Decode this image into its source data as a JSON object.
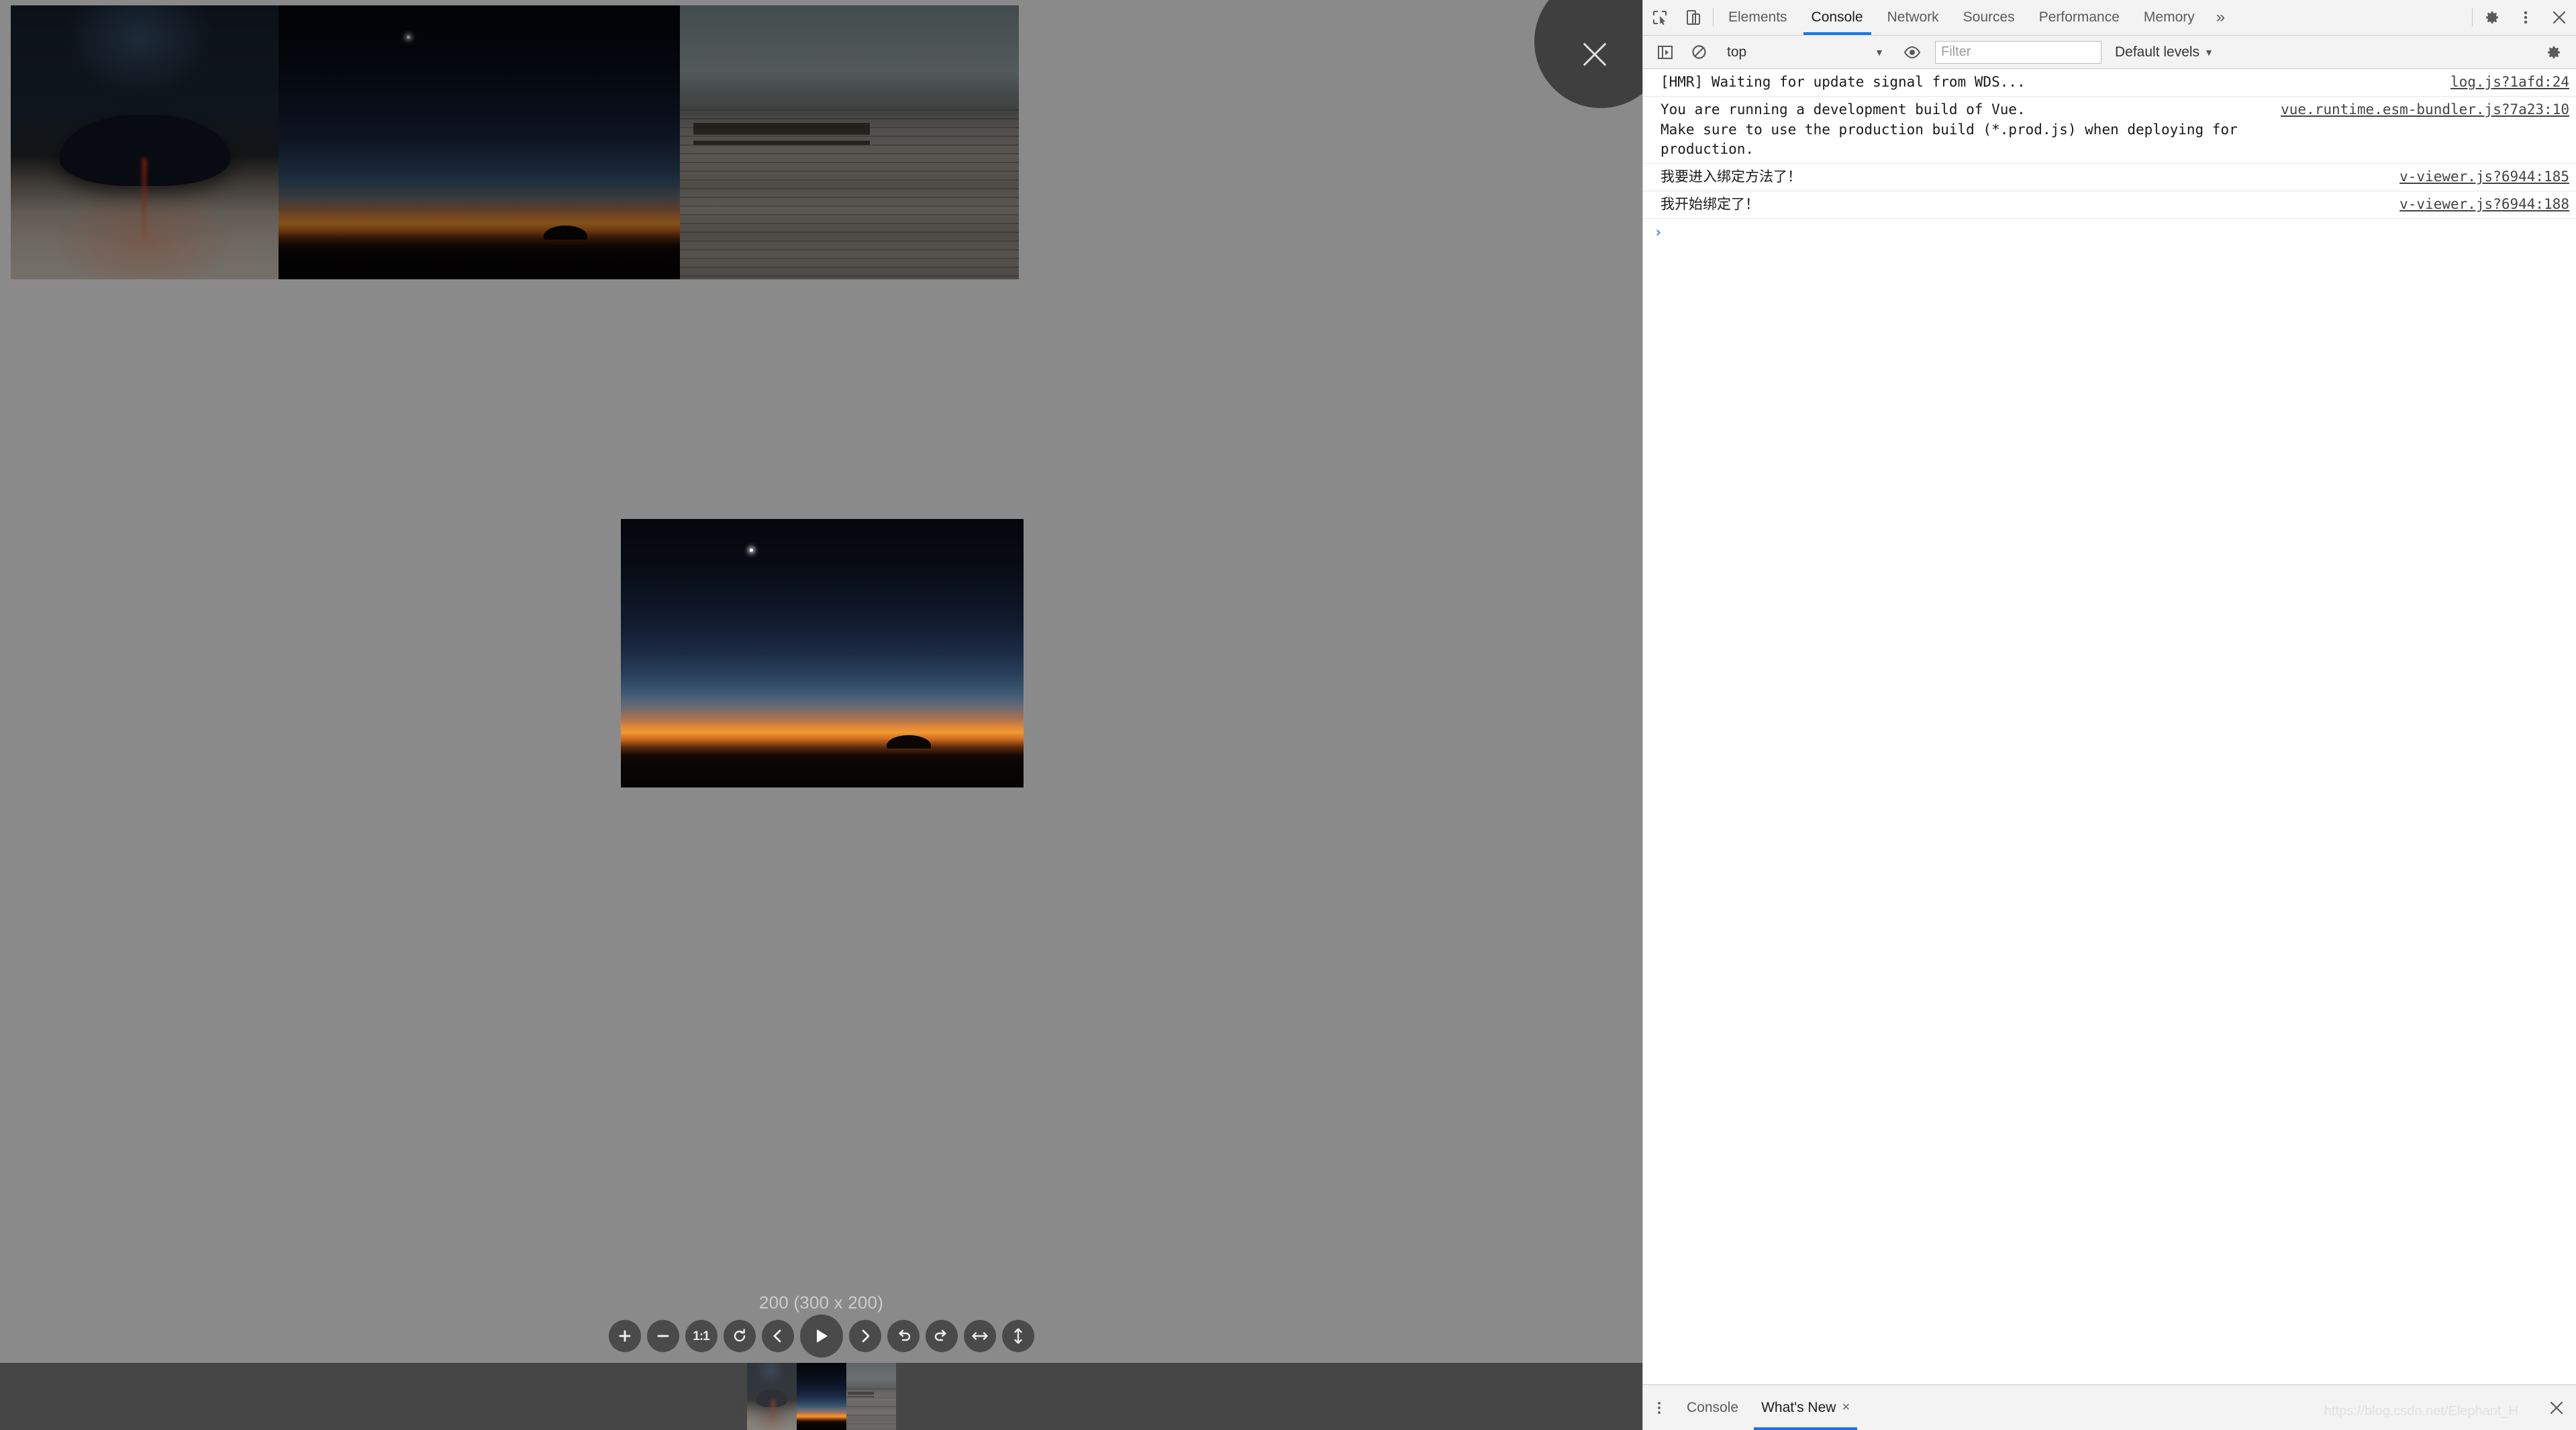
{
  "page": {
    "images": [
      {
        "name": "image-controller",
        "alt": "dark game controller with red light"
      },
      {
        "name": "image-sunset",
        "alt": "twilight horizon with orange glow and a star"
      },
      {
        "name": "image-boardwalk",
        "alt": "wooden boardwalk with bench by the sea"
      }
    ]
  },
  "viewer": {
    "close_label": "×",
    "title": "200 (300 x 200)",
    "active_index": 1,
    "toolbar": [
      {
        "name": "zoom-in-icon",
        "label": "+",
        "title": "Zoom in"
      },
      {
        "name": "zoom-out-icon",
        "label": "−",
        "title": "Zoom out"
      },
      {
        "name": "one-to-one-icon",
        "label": "1:1",
        "title": "Reset zoom (1:1)"
      },
      {
        "name": "reset-icon",
        "label": "",
        "title": "Reset"
      },
      {
        "name": "prev-icon",
        "label": "",
        "title": "Previous"
      },
      {
        "name": "play-icon",
        "label": "",
        "title": "Play slideshow"
      },
      {
        "name": "next-icon",
        "label": "",
        "title": "Next"
      },
      {
        "name": "rotate-left-icon",
        "label": "",
        "title": "Rotate left"
      },
      {
        "name": "rotate-right-icon",
        "label": "",
        "title": "Rotate right"
      },
      {
        "name": "flip-horizontal-icon",
        "label": "",
        "title": "Flip horizontal"
      },
      {
        "name": "flip-vertical-icon",
        "label": "",
        "title": "Flip vertical"
      }
    ],
    "thumbnails": [
      {
        "name": "thumb-controller"
      },
      {
        "name": "thumb-sunset"
      },
      {
        "name": "thumb-boardwalk"
      }
    ]
  },
  "devtools": {
    "tabs": [
      {
        "label": "Elements",
        "active": false
      },
      {
        "label": "Console",
        "active": true
      },
      {
        "label": "Network",
        "active": false
      },
      {
        "label": "Sources",
        "active": false
      },
      {
        "label": "Performance",
        "active": false
      },
      {
        "label": "Memory",
        "active": false
      }
    ],
    "more_label": "»",
    "console_toolbar": {
      "context_value": "top",
      "caret": "▼",
      "filter_placeholder": "Filter",
      "filter_value": "",
      "levels_label": "Default levels",
      "levels_caret": "▼"
    },
    "messages": [
      {
        "text": "[HMR] Waiting for update signal from WDS...",
        "source": "log.js?1afd:24"
      },
      {
        "text": "You are running a development build of Vue.\nMake sure to use the production build (*.prod.js) when deploying for production.",
        "source": "vue.runtime.esm-bundler.js?7a23:10"
      },
      {
        "text": "我要进入绑定方法了！",
        "source": "v-viewer.js?6944:185"
      },
      {
        "text": "我开始绑定了！",
        "source": "v-viewer.js?6944:188"
      }
    ],
    "prompt_caret": "›",
    "prompt_value": "",
    "drawer": {
      "menu_glyph": "⋮",
      "tabs": [
        {
          "label": "Console",
          "active": false,
          "closable": false,
          "close_glyph": ""
        },
        {
          "label": "What's New",
          "active": true,
          "closable": true,
          "close_glyph": "×"
        }
      ],
      "watermark": "https://blog.csdn.net/Elephant_H"
    }
  }
}
